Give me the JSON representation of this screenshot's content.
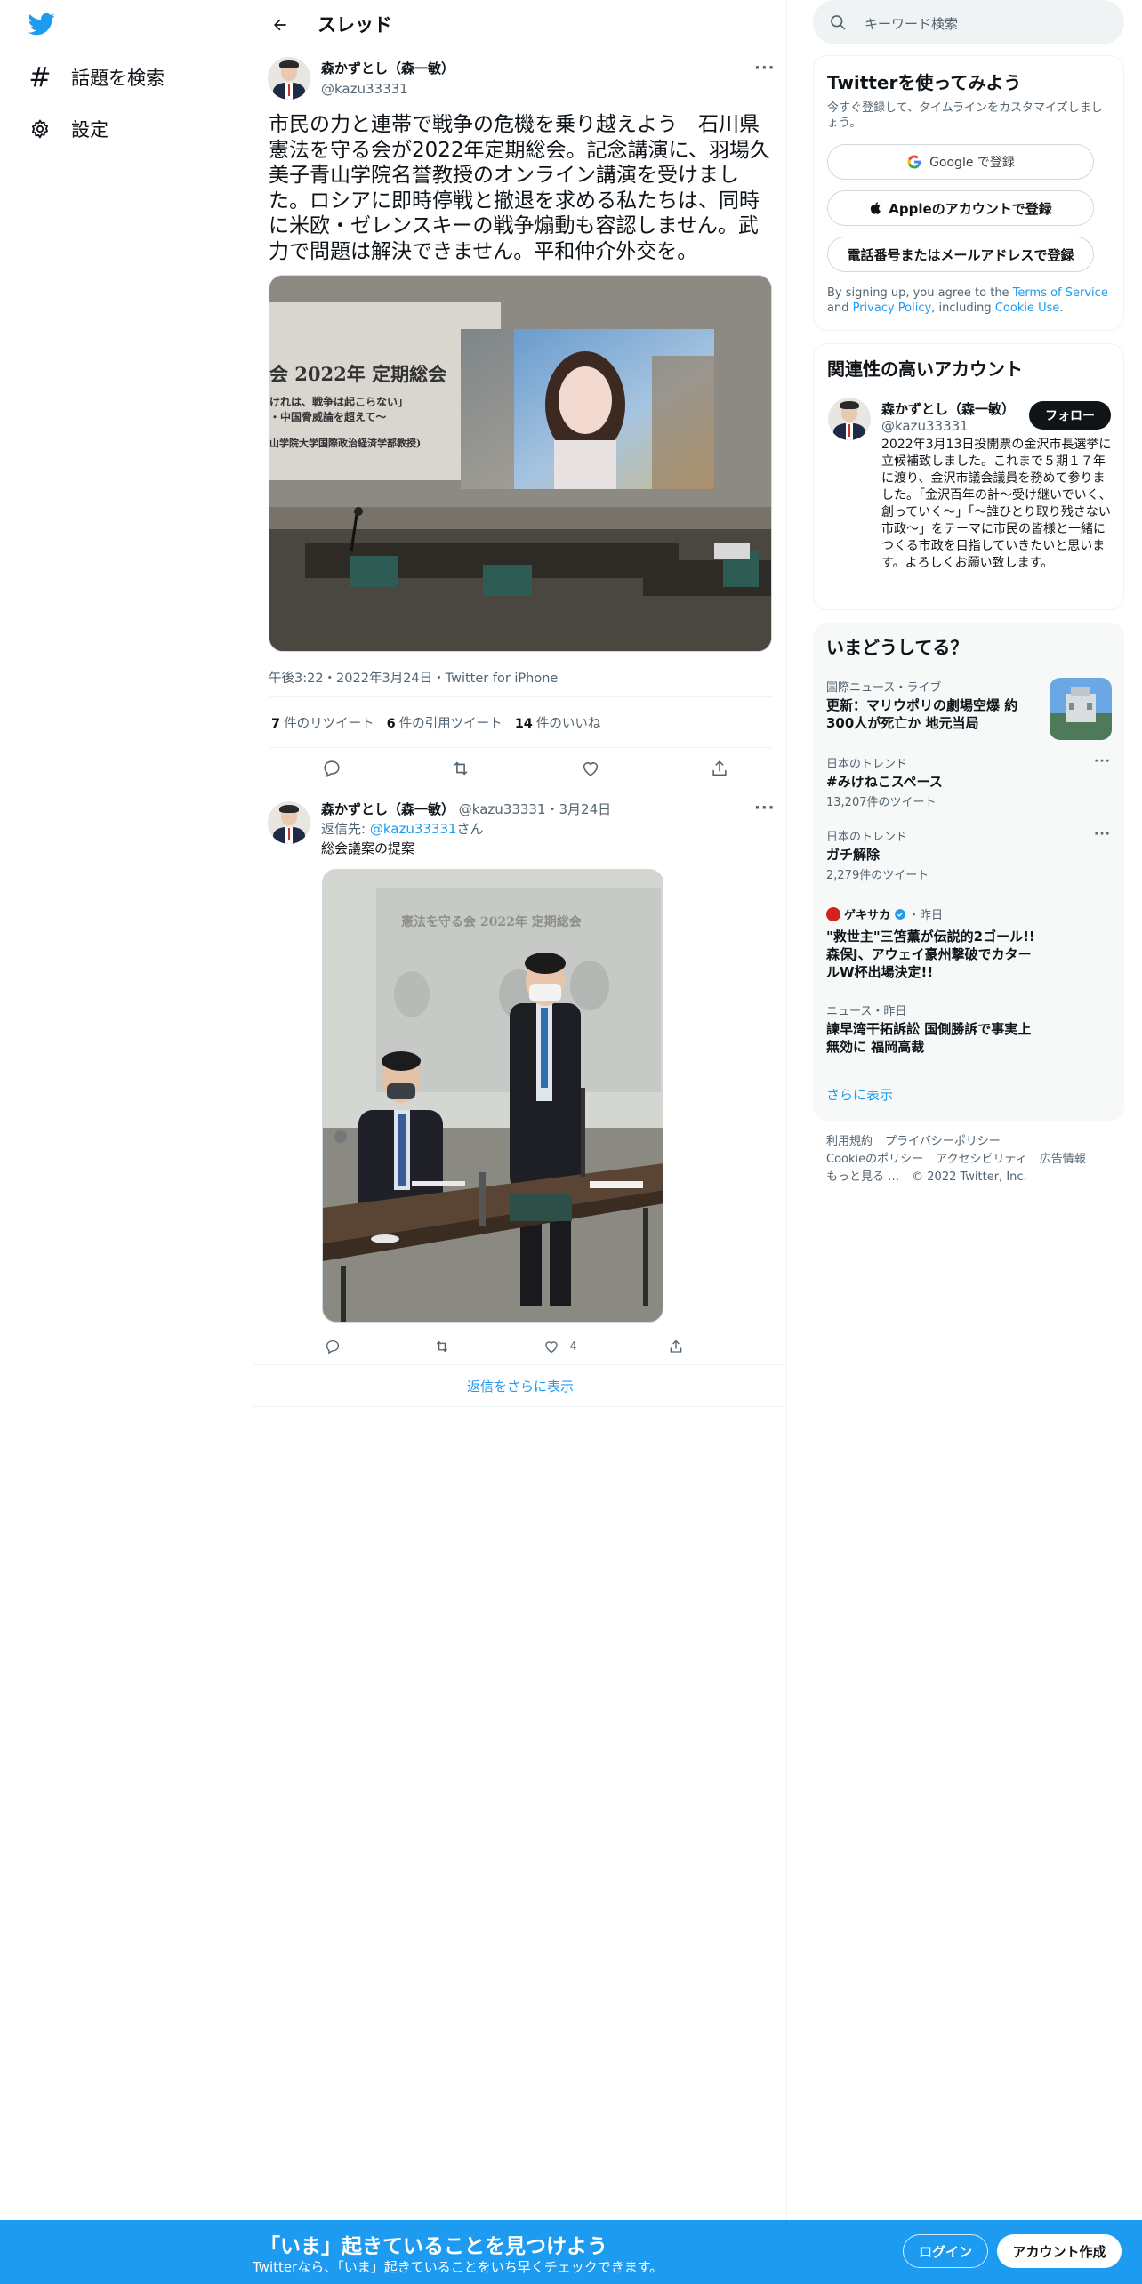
{
  "nav": {
    "explore_label": "話題を検索",
    "settings_label": "設定"
  },
  "thread": {
    "header_title": "スレッド"
  },
  "tweet": {
    "author_name": "森かずとし（森一敏）",
    "author_handle": "@kazu33331",
    "text": "市民の力と連帯で戦争の危機を乗り越えよう　石川県憲法を守る会が2022年定期総会。記念講演に、羽場久美子青山学院名誉教授のオンライン講演を受けました。ロシアに即時停戦と撤退を求める私たちは、同時に米欧・ゼレンスキーの戦争煽動も容認しません。武力で問題は解決できません。平和仲介外交を。",
    "photo": {
      "banner_line1": "会 2022年 定期総会",
      "banner_line2": "けれは、戦争は起こらない」",
      "banner_line3": "・中国脅威論を超えて～",
      "banner_line4": "山学院大学国際政治経済学部教授)"
    },
    "meta": "午後3:22・2022年3月24日・Twitter for iPhone",
    "retweets_count": "7",
    "retweets_label": "件のリツイート",
    "quotes_count": "6",
    "quotes_label": "件の引用ツイート",
    "likes_count": "14",
    "likes_label": "件のいいね"
  },
  "reply": {
    "author_name": "森かずとし（森一敏）",
    "author_sub": " @kazu33331・3月24日",
    "reply_to_prefix": "返信先: ",
    "reply_to_handle": "@kazu33331",
    "reply_to_suffix": "さん",
    "text": "総会議案の提案",
    "photo_banner": "憲法を守る会 2022年 定期総会",
    "like_count": "4",
    "show_more_replies": "返信をさらに表示"
  },
  "sidebar": {
    "search_placeholder": "キーワード検索",
    "signup_card": {
      "title": "Twitterを使ってみよう",
      "subtitle": "今すぐ登録して、タイムラインをカスタマイズしましょう。",
      "google_button": "Google で登録",
      "apple_button": "Appleのアカウントで登録",
      "phone_button": "電話番号またはメールアドレスで登録",
      "terms_prefix": "By signing up, you agree to the ",
      "terms_link": "Terms of Service",
      "terms_and": " and ",
      "privacy_link": "Privacy Policy",
      "terms_including": ", including ",
      "cookie_link": "Cookie Use",
      "terms_end": "."
    },
    "related_card": {
      "title": "関連性の高いアカウント",
      "name": "森かずとし（森一敏）",
      "handle": "@kazu33331",
      "follow_button": "フォロー",
      "bio": "2022年3月13日投開票の金沢市長選挙に立候補致しました。これまで５期１７年に渡り、金沢市議会議員を務めて参りました。「金沢百年の計～受け継いでいく、創っていく～」「～誰ひとり取り残さない市政～」をテーマに市民の皆様と一緒につくる市政を目指していきたいと思います。よろしくお願い致します。"
    },
    "trends_card": {
      "title": "いまどうしてる？",
      "items": [
        {
          "meta": "国際ニュース・ライブ",
          "title": "更新：マリウポリの劇場空爆 約300人が死亡か 地元当局"
        },
        {
          "meta": "日本のトレンド",
          "title": "#みけねこスペース",
          "count": "13,207件のツイート"
        },
        {
          "meta": "日本のトレンド",
          "title": "ガチ解除",
          "count": "2,279件のツイート"
        },
        {
          "meta_source": "ゲキサカ",
          "meta_time": "・昨日",
          "title": "\"救世主\"三笘薫が伝説的2ゴール!! 森保J、アウェイ豪州撃破でカタールW杯出場決定!!"
        },
        {
          "meta": "ニュース・昨日",
          "title": "諫早湾干拓訴訟 国側勝訴で事実上無効に 福岡高裁"
        }
      ],
      "show_more": "さらに表示"
    },
    "footer": {
      "links": [
        "利用規約",
        "プライバシーポリシー",
        "Cookieのポリシー",
        "アクセシビリティ",
        "広告情報",
        "もっと見る …"
      ],
      "copyright": "© 2022 Twitter, Inc."
    }
  },
  "bottom_bar": {
    "title": "「いま」起きていることを見つけよう",
    "subtitle": "Twitterなら、「いま」起きていることをいち早くチェックできます。",
    "login": "ログイン",
    "signup": "アカウント作成"
  },
  "colors": {
    "brand": "#1d9bf0",
    "text": "#0f1419",
    "secondary": "#536471"
  },
  "icons": [
    "twitter-bird-icon",
    "hashtag-icon",
    "gear-icon",
    "back-arrow-icon",
    "more-icon",
    "reply-icon",
    "retweet-icon",
    "like-icon",
    "share-icon",
    "search-icon",
    "google-icon",
    "apple-icon",
    "verified-icon"
  ]
}
